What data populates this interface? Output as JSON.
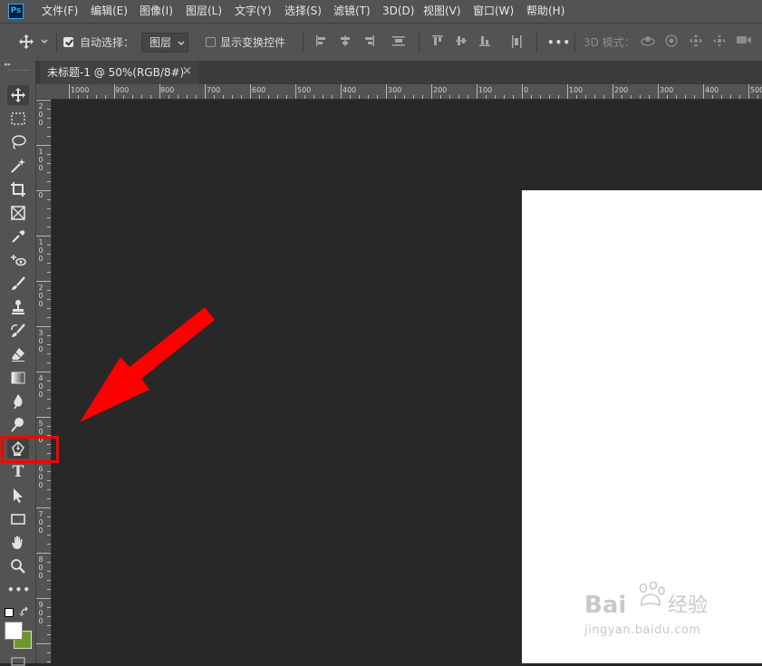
{
  "app": {
    "logo_text": "Ps",
    "colors": {
      "menubar": "#535353",
      "canvas": "#282828",
      "document": "#ffffff",
      "annotation": "#ff0000"
    }
  },
  "menu": {
    "items": [
      "文件(F)",
      "编辑(E)",
      "图像(I)",
      "图层(L)",
      "文字(Y)",
      "选择(S)",
      "滤镜(T)",
      "3D(D)",
      "视图(V)",
      "窗口(W)",
      "帮助(H)"
    ]
  },
  "options": {
    "auto_select_label": "自动选择：",
    "auto_select_checked": true,
    "layer_select_value": "图层",
    "show_transform_label": "显示变换控件",
    "show_transform_checked": false,
    "mode_3d_label": "3D 模式：",
    "more_glyph": "•••"
  },
  "document_tab": {
    "title": "未标题-1 @ 50%(RGB/8#)",
    "close_glyph": "×"
  },
  "rulers": {
    "horizontal": [
      "1000",
      "900",
      "800",
      "700",
      "600",
      "500",
      "400",
      "300",
      "200",
      "100",
      "0",
      "100",
      "200",
      "300",
      "400",
      "500"
    ],
    "vertical": [
      "2\n0\n0",
      "1\n0\n0",
      "0",
      "1\n0\n0",
      "2\n0\n0",
      "3\n0\n0",
      "4\n0\n0",
      "5\n0\n0",
      "6\n0\n0",
      "7\n0\n0",
      "8\n0\n0",
      "9\n0\n0"
    ]
  },
  "toolbox": {
    "collapse_glyph": "▸▸",
    "tools": [
      "move",
      "marquee",
      "lasso",
      "magic-wand",
      "crop",
      "frame",
      "eyedropper",
      "healing",
      "brush",
      "stamp",
      "history-brush",
      "eraser",
      "gradient",
      "blur",
      "dodge",
      "pen",
      "type",
      "path-select",
      "rectangle",
      "hand",
      "zoom",
      "more"
    ],
    "active_tool": "pen",
    "more_glyph": "•••",
    "foreground_color": "#ffffff",
    "background_color": "#6b9a2b"
  },
  "watermark": {
    "brand": "Bai",
    "brand_suffix": "经验",
    "url": "jingyan.baidu.com"
  }
}
